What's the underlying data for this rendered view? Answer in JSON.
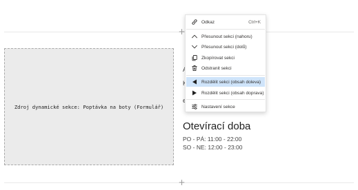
{
  "dynamic_section": {
    "placeholder_text": "Zdroj dynamické sekce: Poptávka na boty (Formulář)"
  },
  "context_menu": {
    "items": [
      {
        "label": "Odkaz",
        "shortcut": "Ctrl+K",
        "icon": "link-icon"
      },
      {
        "label": "Přesunout sekci (nahoru)",
        "icon": "chevron-up-icon"
      },
      {
        "label": "Přesunout sekci (dolů)",
        "icon": "chevron-down-icon"
      },
      {
        "label": "Zkopírovat sekci",
        "icon": "copy-icon"
      },
      {
        "label": "Odstranit sekci",
        "icon": "trash-icon"
      },
      {
        "label": "Rozdělit sekci (obsah doleva)",
        "icon": "triangle-left-icon",
        "selected": true
      },
      {
        "label": "Rozdělit sekci (obsah doprava)",
        "icon": "triangle-right-icon"
      },
      {
        "label": "Nastavení sekce",
        "icon": "settings-sliders-icon"
      }
    ]
  },
  "opening_hours": {
    "title": "Otevírací doba",
    "weekdays": "PO - PÁ: 11:00 - 22:00",
    "weekend": "SO - NE: 12:00 - 23:00"
  },
  "add_section_symbol": "+",
  "partial_letters": [
    "A",
    "K",
    "e"
  ],
  "colors": {
    "selected_item": "#cfe4fa",
    "placeholder_bg": "#ebebeb",
    "divider": "#e8e8e8"
  }
}
